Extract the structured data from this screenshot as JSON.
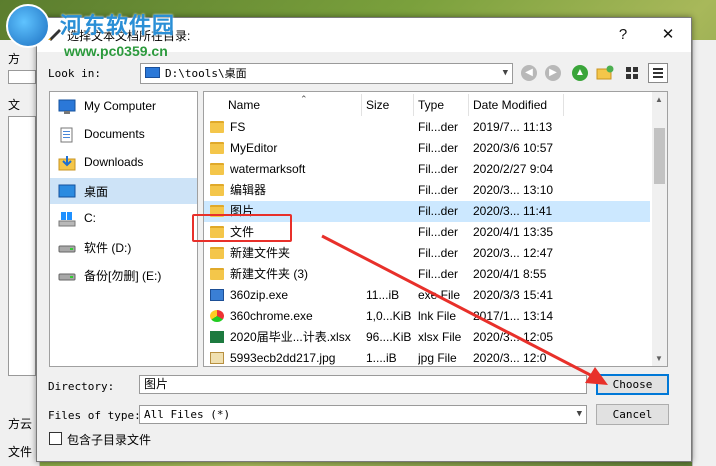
{
  "watermark": {
    "site_name": "河东软件园",
    "url": "www.pc0359.cn"
  },
  "background_app": {
    "labels": [
      "方",
      "文",
      "方云",
      "文件"
    ]
  },
  "dialog": {
    "title": "选择文本文档所在目录:",
    "help_glyph": "?",
    "close_glyph": "✕",
    "look_in_label": "Look in:",
    "look_in_value": "D:\\tools\\桌面",
    "sidebar": [
      {
        "label": "My Computer",
        "icon": "computer-icon"
      },
      {
        "label": "Documents",
        "icon": "documents-icon"
      },
      {
        "label": "Downloads",
        "icon": "downloads-icon"
      },
      {
        "label": "桌面",
        "icon": "desktop-icon",
        "selected": true
      },
      {
        "label": "C:",
        "icon": "windows-drive-icon"
      },
      {
        "label": "软件 (D:)",
        "icon": "drive-icon"
      },
      {
        "label": "备份[勿删] (E:)",
        "icon": "drive-icon"
      }
    ],
    "columns": {
      "name": "Name",
      "size": "Size",
      "type": "Type",
      "date": "Date Modified"
    },
    "files": [
      {
        "name": "FS",
        "size": "",
        "type": "Fil...der",
        "date": "2019/7... 11:13",
        "kind": "folder"
      },
      {
        "name": "MyEditor",
        "size": "",
        "type": "Fil...der",
        "date": "2020/3/6 10:57",
        "kind": "folder"
      },
      {
        "name": "watermarksoft",
        "size": "",
        "type": "Fil...der",
        "date": "2020/2/27 9:04",
        "kind": "folder"
      },
      {
        "name": "编辑器",
        "size": "",
        "type": "Fil...der",
        "date": "2020/3... 13:10",
        "kind": "folder"
      },
      {
        "name": "图片",
        "size": "",
        "type": "Fil...der",
        "date": "2020/3... 11:41",
        "kind": "folder",
        "selected": true
      },
      {
        "name": "文件",
        "size": "",
        "type": "Fil...der",
        "date": "2020/4/1 13:35",
        "kind": "folder"
      },
      {
        "name": "新建文件夹",
        "size": "",
        "type": "Fil...der",
        "date": "2020/3... 12:47",
        "kind": "folder"
      },
      {
        "name": "新建文件夹 (3)",
        "size": "",
        "type": "Fil...der",
        "date": "2020/4/1 8:55",
        "kind": "folder"
      },
      {
        "name": "360zip.exe",
        "size": "11...iB",
        "type": "exe File",
        "date": "2020/3/3 15:41",
        "kind": "exe-zip"
      },
      {
        "name": "360chrome.exe",
        "size": "1,0...KiB",
        "type": "lnk File",
        "date": "2017/1... 13:14",
        "kind": "exe-chrome"
      },
      {
        "name": "2020届毕业...计表.xlsx",
        "size": "96....KiB",
        "type": "xlsx File",
        "date": "2020/3... 12:05",
        "kind": "xlsx"
      },
      {
        "name": "5993ecb2dd217.jpg",
        "size": "1....iB",
        "type": "jpg File",
        "date": "2020/3... 12:0",
        "kind": "jpg"
      }
    ],
    "directory_label": "Directory:",
    "directory_value": "图片",
    "files_of_type_label": "Files of type:",
    "files_of_type_value": "All Files (*)",
    "choose_button": "Choose",
    "cancel_button": "Cancel",
    "include_subdirs_label": "包含子目录文件"
  },
  "colors": {
    "selection": "#cce8ff",
    "annotation": "#e8302a",
    "accent": "#0078d7"
  }
}
